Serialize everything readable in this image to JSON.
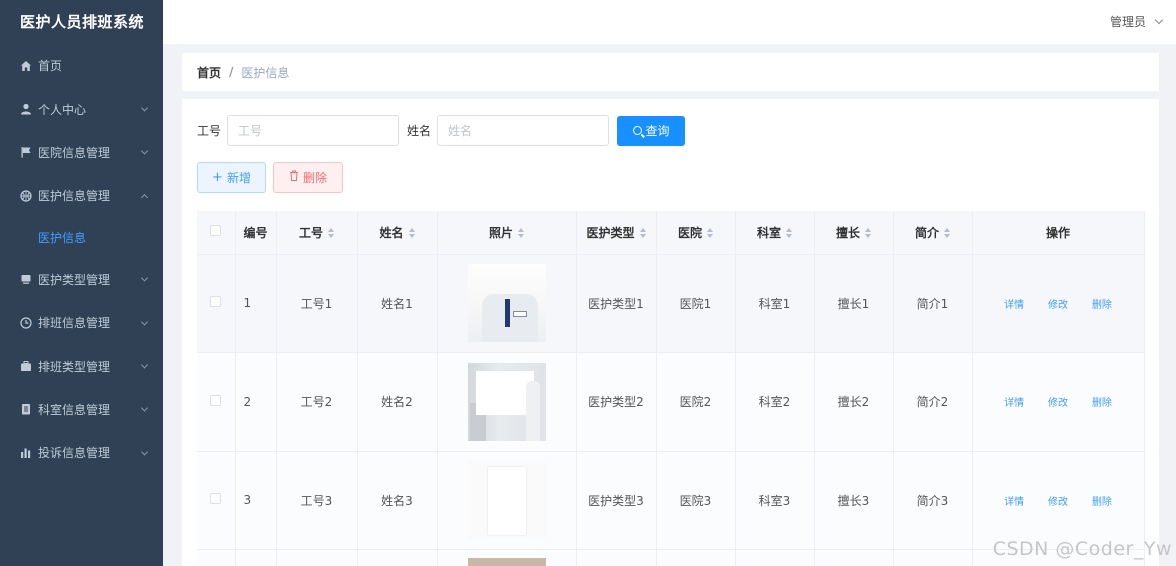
{
  "app": {
    "title": "医护人员排班系统"
  },
  "sidebar": {
    "items": [
      {
        "label": "首页",
        "icon": "home-icon",
        "has_children": false
      },
      {
        "label": "个人中心",
        "icon": "user-icon",
        "has_children": true
      },
      {
        "label": "医院信息管理",
        "icon": "flag-icon",
        "has_children": true
      },
      {
        "label": "医护信息管理",
        "icon": "basketball-icon",
        "has_children": true,
        "expanded": true,
        "children": [
          "医护信息"
        ]
      },
      {
        "label": "医护类型管理",
        "icon": "monitor-icon",
        "has_children": true
      },
      {
        "label": "排班信息管理",
        "icon": "clock-icon",
        "has_children": true
      },
      {
        "label": "排班类型管理",
        "icon": "briefcase-icon",
        "has_children": true
      },
      {
        "label": "科室信息管理",
        "icon": "document-icon",
        "has_children": true
      },
      {
        "label": "投诉信息管理",
        "icon": "bar-chart-icon",
        "has_children": true
      }
    ],
    "active_child": "医护信息"
  },
  "header": {
    "user": "管理员"
  },
  "breadcrumb": {
    "home": "首页",
    "separator": "/",
    "current": "医护信息"
  },
  "search": {
    "id_label": "工号",
    "id_placeholder": "工号",
    "name_label": "姓名",
    "name_placeholder": "姓名",
    "query_label": "查询"
  },
  "actions": {
    "add_label": "新增",
    "delete_label": "删除"
  },
  "table": {
    "columns": [
      "编号",
      "工号",
      "姓名",
      "照片",
      "医护类型",
      "医院",
      "科室",
      "擅长",
      "简介",
      "操作"
    ],
    "rows": [
      {
        "id": "1",
        "staff_no": "工号1",
        "name": "姓名1",
        "type": "医护类型1",
        "hospital": "医院1",
        "dept": "科室1",
        "specialty": "擅长1",
        "intro": "简介1"
      },
      {
        "id": "2",
        "staff_no": "工号2",
        "name": "姓名2",
        "type": "医护类型2",
        "hospital": "医院2",
        "dept": "科室2",
        "specialty": "擅长2",
        "intro": "简介2"
      },
      {
        "id": "3",
        "staff_no": "工号3",
        "name": "姓名3",
        "type": "医护类型3",
        "hospital": "医院3",
        "dept": "科室3",
        "specialty": "擅长3",
        "intro": "简介3"
      }
    ],
    "row_actions": {
      "detail": "详情",
      "edit": "修改",
      "delete": "删除"
    }
  },
  "watermark": "CSDN @Coder_Yw",
  "colors": {
    "sidebar_bg": "#304156",
    "primary": "#1890ff",
    "link": "#409eff",
    "danger": "#f56c6c"
  }
}
